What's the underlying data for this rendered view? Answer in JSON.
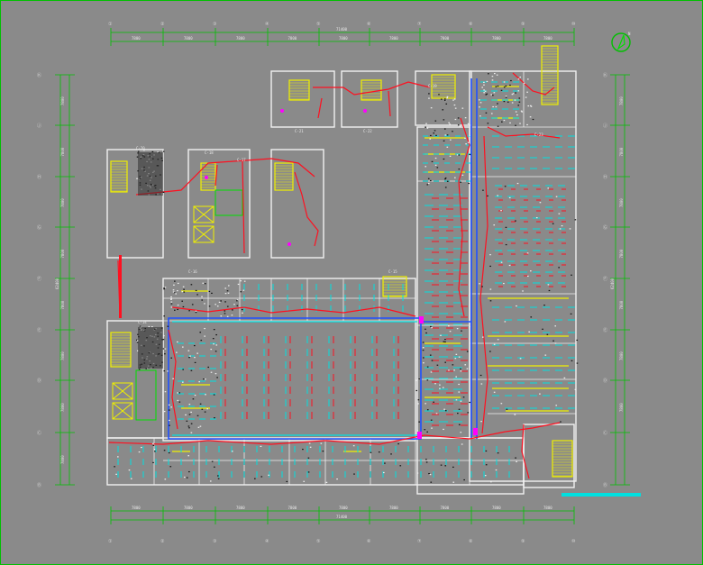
{
  "drawing": {
    "dims": {
      "top_total": "71400",
      "top_segments": [
        "7800",
        "7800",
        "7800",
        "7800",
        "7800",
        "7800",
        "7800",
        "7800",
        "7800"
      ],
      "bottom_total": "71400",
      "bottom_segments": [
        "7800",
        "7800",
        "7800",
        "7800",
        "7800",
        "7800",
        "7800",
        "7800",
        "7800"
      ],
      "left_segments": [
        "7800",
        "7800",
        "7800",
        "7800",
        "7800",
        "7800",
        "7800",
        "7800"
      ],
      "left_total": "62400",
      "right_segments": [
        "7800",
        "7800",
        "7800",
        "7800",
        "7800",
        "7800",
        "7800"
      ],
      "right_total": "62400"
    },
    "axis_labels": {
      "top": [
        "①",
        "②",
        "③",
        "④",
        "⑤",
        "⑥",
        "⑦",
        "⑧",
        "⑨",
        "⑩"
      ],
      "bottom": [
        "①",
        "②",
        "③",
        "④",
        "⑤",
        "⑥",
        "⑦",
        "⑧",
        "⑨",
        "⑩"
      ],
      "left": [
        "Ⓚ",
        "Ⓙ",
        "Ⓗ",
        "Ⓖ",
        "Ⓕ",
        "Ⓔ",
        "Ⓓ",
        "Ⓒ",
        "Ⓑ"
      ],
      "right": [
        "Ⓚ",
        "Ⓙ",
        "Ⓗ",
        "Ⓖ",
        "Ⓕ",
        "Ⓔ",
        "Ⓓ",
        "Ⓒ",
        "Ⓑ"
      ]
    },
    "room_tags": [
      "C-21",
      "C-22",
      "C-19",
      "C-20",
      "C-18",
      "C-17",
      "C-16",
      "C-15",
      "C-14",
      "C-23"
    ],
    "colors": {
      "background": "#8a8a8a",
      "axis": "#00c000",
      "wiring": "#ff1020",
      "cable_tray": "#2050ff",
      "fixtures": "#00e0e0",
      "walls": "#f0f0f0",
      "stairs": "#f0f000",
      "accent_magenta": "#ff00ff"
    },
    "icons": {
      "north_arrow": "north-arrow-icon"
    }
  }
}
